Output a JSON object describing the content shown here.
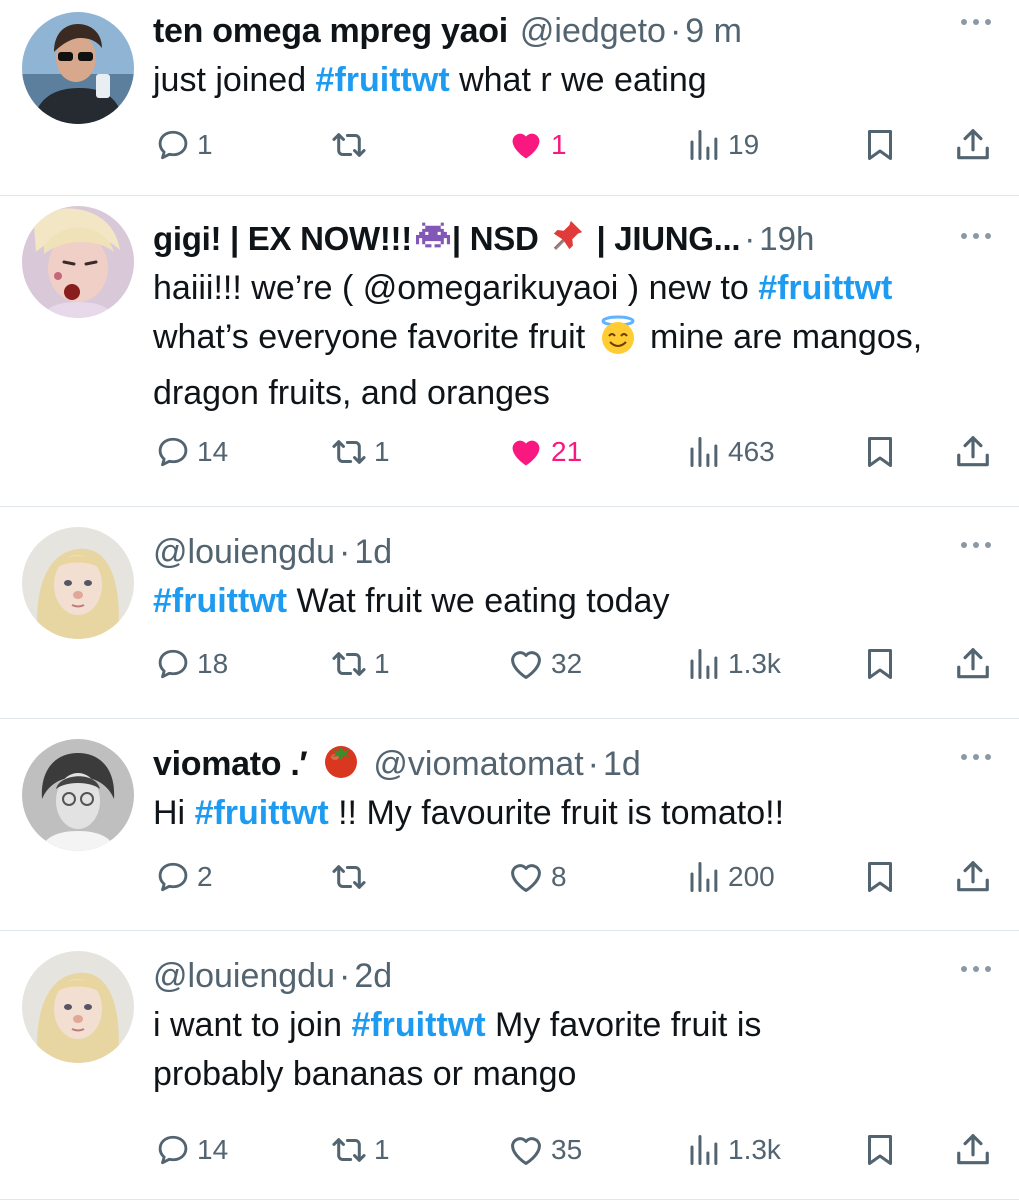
{
  "tweets": [
    {
      "display_name": "ten omega mpreg yaoi",
      "handle": "@iedgeto",
      "time": "9 m",
      "pre": "just joined ",
      "tag": "#fruittwt",
      "post": " what r we eating",
      "replies": "1",
      "retweets": "",
      "likes": "1",
      "liked": true,
      "views": "19"
    },
    {
      "display_name": "gigi! | EX NOW!!!",
      "display_name_mid": "| NSD",
      "display_name_end": "| JIUNG...",
      "handle": "",
      "time": "19h",
      "pre": "haiii!!! we’re ( @omegarikuyaoi ) new to ",
      "tag": "#fruittwt",
      "post_a": "what’s everyone favorite fruit ",
      "post_b": " mine are mangos, dragon fruits, and oranges",
      "replies": "14",
      "retweets": "1",
      "likes": "21",
      "liked": true,
      "views": "463"
    },
    {
      "display_name": "",
      "handle": "@louiengdu",
      "time": "1d",
      "pre": "",
      "tag": "#fruittwt",
      "post": " Wat fruit we eating today",
      "replies": "18",
      "retweets": "1",
      "likes": "32",
      "liked": false,
      "views": "1.3k"
    },
    {
      "display_name": "viomato .′",
      "handle": "@viomatomat",
      "time": "1d",
      "pre": "Hi ",
      "tag": "#fruittwt",
      "post": " !! My favourite fruit is tomato!!",
      "replies": "2",
      "retweets": "",
      "likes": "8",
      "liked": false,
      "views": "200"
    },
    {
      "display_name": "",
      "handle": "@louiengdu",
      "time": "2d",
      "pre": "i want to join ",
      "tag": "#fruittwt",
      "post": " My favorite fruit is probably bananas or mango",
      "replies": "14",
      "retweets": "1",
      "likes": "35",
      "liked": false,
      "views": "1.3k"
    }
  ],
  "separator": "·",
  "icons": [
    "reply-icon",
    "retweet-icon",
    "heart-icon",
    "views-icon",
    "bookmark-icon",
    "share-icon",
    "more-icon"
  ],
  "colors": {
    "hashtag": "#1d9bf0",
    "like": "#f91880",
    "secondary": "#536471",
    "text": "#0f1419"
  }
}
